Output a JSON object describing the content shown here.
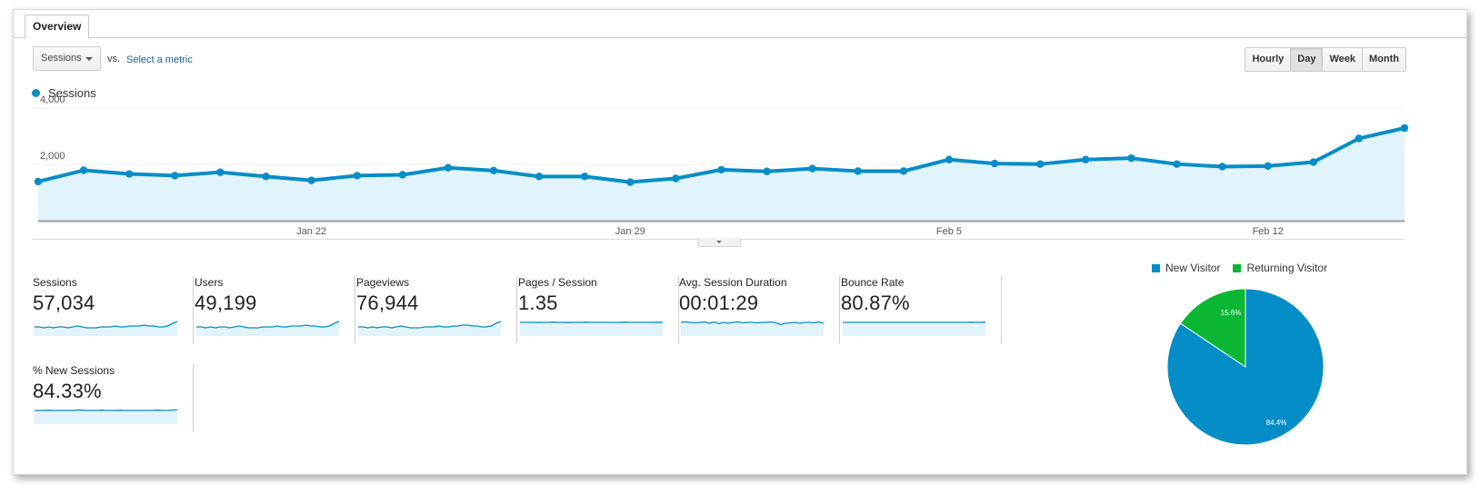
{
  "tabs": [
    {
      "label": "Overview",
      "active": true
    }
  ],
  "controls": {
    "primary_metric": "Sessions",
    "vs_label": "vs.",
    "select_metric_link": "Select a metric",
    "granularity": [
      {
        "label": "Hourly",
        "active": false
      },
      {
        "label": "Day",
        "active": true
      },
      {
        "label": "Week",
        "active": false
      },
      {
        "label": "Month",
        "active": false
      }
    ]
  },
  "colors": {
    "series": "#058dc7",
    "area_fill": "#e1f3fb",
    "grid": "#eeeeee",
    "axis": "#9a9a9a",
    "new_visitor": "#058dc7",
    "returning_visitor": "#0ab634"
  },
  "chart_data": [
    {
      "type": "area",
      "title": "",
      "legend": [
        "Sessions"
      ],
      "legend_position": "top-left",
      "xlabel": "",
      "ylabel": "",
      "ylim": [
        0,
        4000
      ],
      "yticks": [
        {
          "value": 4000,
          "label": "4,000"
        },
        {
          "value": 2000,
          "label": "2,000"
        }
      ],
      "x": [
        "Jan 16",
        "Jan 17",
        "Jan 18",
        "Jan 19",
        "Jan 20",
        "Jan 21",
        "Jan 22",
        "Jan 23",
        "Jan 24",
        "Jan 25",
        "Jan 26",
        "Jan 27",
        "Jan 28",
        "Jan 29",
        "Jan 30",
        "Jan 31",
        "Feb 1",
        "Feb 2",
        "Feb 3",
        "Feb 4",
        "Feb 5",
        "Feb 6",
        "Feb 7",
        "Feb 8",
        "Feb 9",
        "Feb 10",
        "Feb 11",
        "Feb 12",
        "Feb 13",
        "Feb 14",
        "Feb 15"
      ],
      "xtick_labels": [
        {
          "index": 6,
          "label": "Jan 22"
        },
        {
          "index": 13,
          "label": "Jan 29"
        },
        {
          "index": 20,
          "label": "Feb 5"
        },
        {
          "index": 27,
          "label": "Feb 12"
        }
      ],
      "series": [
        {
          "name": "Sessions",
          "values": [
            1390,
            1790,
            1660,
            1600,
            1720,
            1570,
            1430,
            1600,
            1630,
            1880,
            1780,
            1570,
            1570,
            1370,
            1500,
            1810,
            1750,
            1850,
            1760,
            1760,
            2170,
            2030,
            2010,
            2170,
            2220,
            2010,
            1920,
            1940,
            2080,
            2920,
            3290
          ]
        }
      ],
      "grid": true
    },
    {
      "type": "pie",
      "legend_position": "top",
      "slices": [
        {
          "label": "New Visitor",
          "value": 84.4,
          "display": "84.4%"
        },
        {
          "label": "Returning Visitor",
          "value": 15.6,
          "display": "15.6%"
        }
      ]
    }
  ],
  "scorecards": [
    {
      "label": "Sessions",
      "value": "57,034",
      "spark": [
        10,
        10,
        9,
        10,
        9,
        10,
        10,
        9,
        10,
        11,
        10,
        9,
        9,
        9,
        10,
        10,
        10,
        11,
        10,
        10,
        11,
        11,
        11,
        12,
        11,
        11,
        10,
        10,
        11,
        14,
        16
      ]
    },
    {
      "label": "Users",
      "value": "49,199",
      "spark": [
        10,
        10,
        9,
        10,
        9,
        10,
        10,
        9,
        10,
        11,
        10,
        9,
        9,
        9,
        10,
        10,
        10,
        11,
        10,
        10,
        11,
        11,
        11,
        12,
        11,
        11,
        10,
        10,
        11,
        14,
        16
      ]
    },
    {
      "label": "Pageviews",
      "value": "76,944",
      "spark": [
        10,
        10,
        9,
        10,
        9,
        10,
        10,
        9,
        10,
        11,
        10,
        9,
        9,
        9,
        10,
        10,
        10,
        11,
        10,
        10,
        11,
        11,
        12,
        12,
        11,
        11,
        10,
        10,
        11,
        14,
        16
      ]
    },
    {
      "label": "Pages / Session",
      "value": "1.35",
      "spark": [
        15,
        15,
        15,
        15,
        14.8,
        15,
        15,
        15.3,
        15,
        15,
        14.8,
        15,
        15,
        15,
        15.2,
        15,
        15,
        15,
        15,
        14.9,
        15,
        15,
        15.2,
        15,
        15,
        15,
        15,
        15,
        15,
        15.2,
        15
      ]
    },
    {
      "label": "Avg. Session Duration",
      "value": "00:01:29",
      "spark": [
        15,
        15.5,
        15,
        14.5,
        15,
        15.5,
        14,
        15.5,
        13.5,
        15,
        14,
        15,
        15.5,
        14.5,
        15,
        15,
        14.5,
        15,
        15,
        15.5,
        14.5,
        12.5,
        14,
        14.5,
        15,
        14,
        15,
        15,
        14.5,
        15.5,
        14
      ]
    },
    {
      "label": "Bounce Rate",
      "value": "80.87%",
      "spark": [
        15,
        15,
        15,
        15,
        15,
        15,
        15,
        15,
        15,
        15,
        15,
        15,
        15,
        15,
        15,
        15,
        15,
        15,
        15,
        15,
        15,
        15,
        15,
        15,
        15,
        15,
        15,
        15.2,
        15,
        15,
        15.2
      ]
    },
    {
      "label": "% New Sessions",
      "value": "84.33%",
      "spark": [
        15,
        15,
        15,
        15.2,
        15,
        15,
        15,
        15,
        15,
        15.5,
        15.3,
        15,
        15,
        15,
        15.3,
        15,
        15,
        15,
        15.2,
        15,
        15,
        15,
        15,
        15,
        15,
        15.1,
        15.3,
        15,
        15.1,
        15.4,
        15.6
      ]
    }
  ]
}
